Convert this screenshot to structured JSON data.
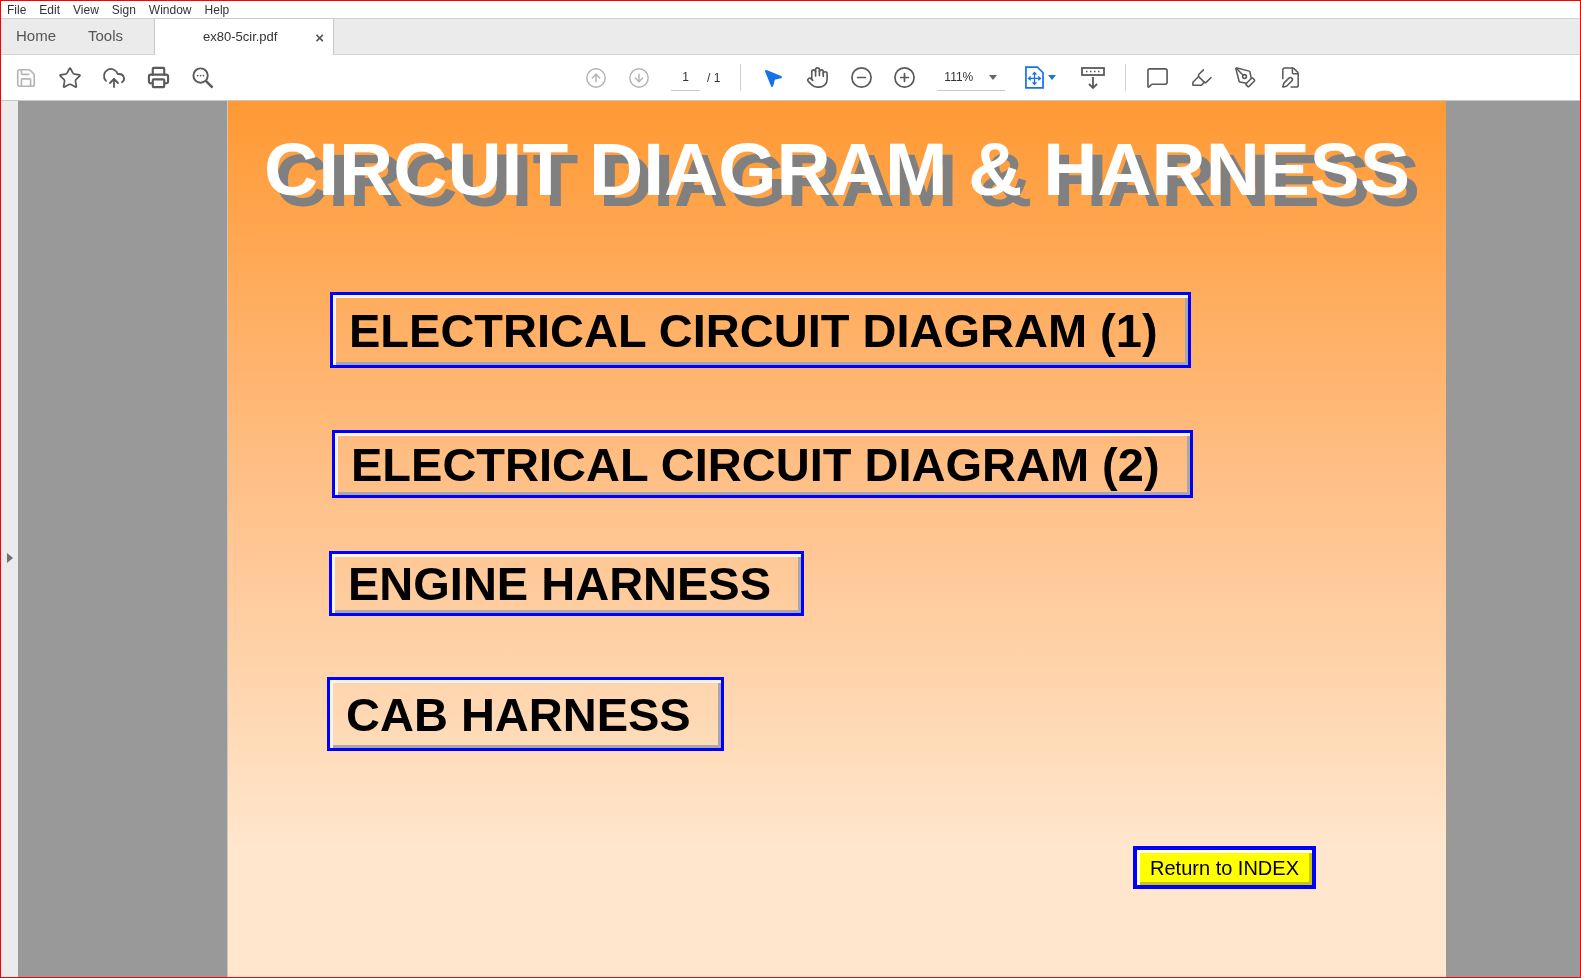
{
  "menu_bar": [
    "File",
    "Edit",
    "View",
    "Sign",
    "Window",
    "Help"
  ],
  "tabs": [
    {
      "kind": "nav",
      "label": "Home",
      "selected": false
    },
    {
      "kind": "nav",
      "label": "Tools",
      "selected": false
    },
    {
      "kind": "document",
      "label": "ex80-5cir.pdf",
      "selected": true,
      "close": "×"
    }
  ],
  "toolbar": {
    "save": {
      "disabled": true
    },
    "previous_page": {
      "disabled": true
    },
    "next_page": {
      "disabled": true
    },
    "page_field": {
      "value": "1"
    },
    "page_count": "/ 1",
    "select_tool": {
      "selected": true
    },
    "hand_tool": {
      "selected": false
    },
    "zoom_field": {
      "value": "111%"
    }
  },
  "document": {
    "title": "CIRCUIT DIAGRAM & HARNESS",
    "links": [
      "ELECTRICAL CIRCUIT DIAGRAM (1)",
      "ELECTRICAL CIRCUIT DIAGRAM (2)",
      "ENGINE HARNESS",
      "CAB HARNESS"
    ],
    "return_button": "Return to INDEX"
  }
}
